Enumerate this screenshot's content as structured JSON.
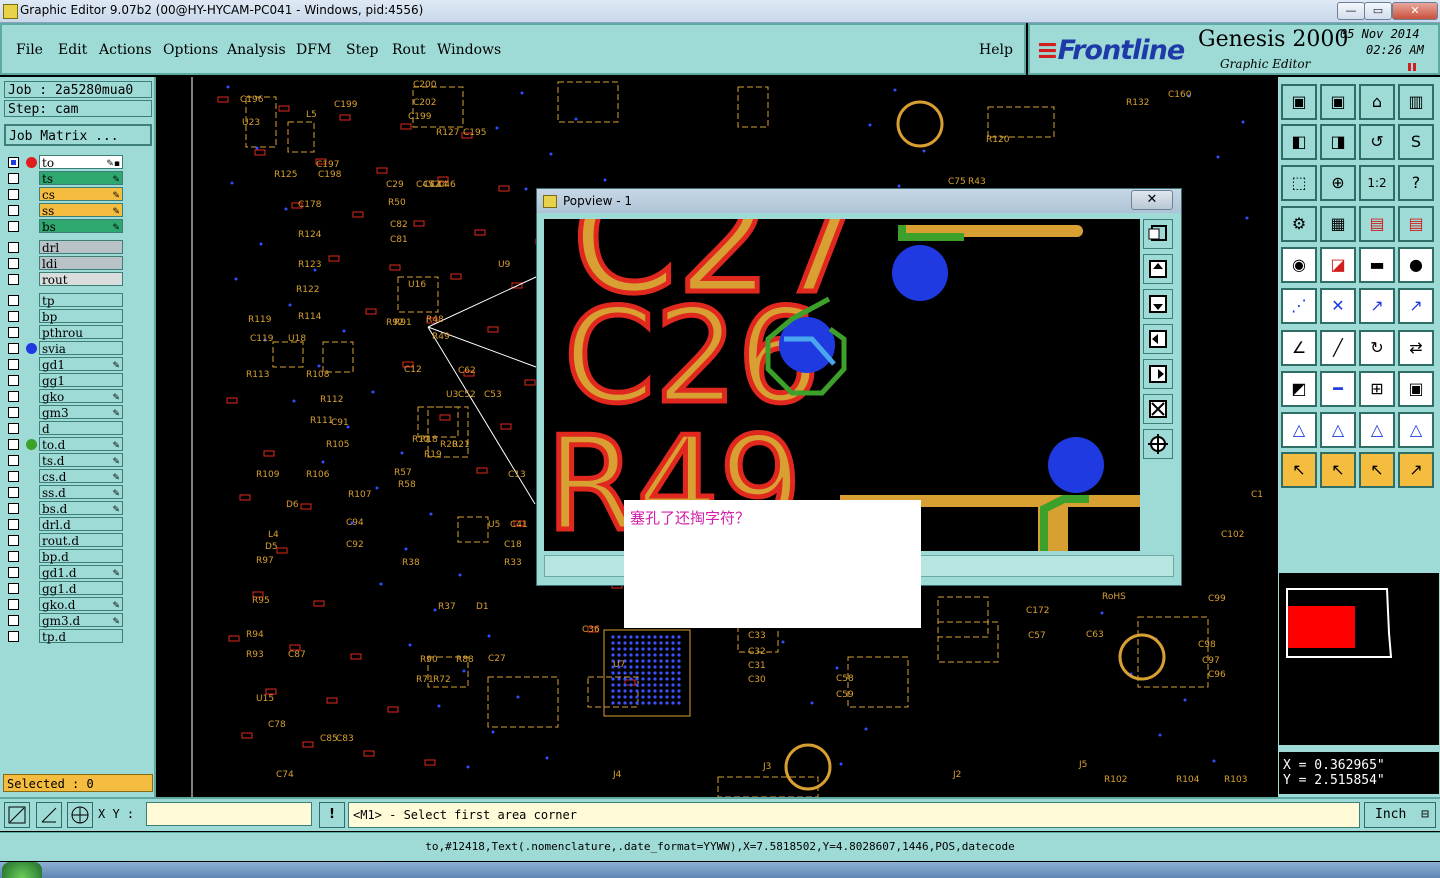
{
  "window": {
    "title": "Graphic Editor 9.07b2 (00@HY-HYCAM-PC041 - Windows, pid:4556)",
    "controls": [
      "—",
      "▭",
      "✕"
    ]
  },
  "menubar": {
    "items": [
      "File",
      "Edit",
      "Actions",
      "Options",
      "Analysis",
      "DFM",
      "Step",
      "Rout",
      "Windows"
    ],
    "help": "Help"
  },
  "brand": {
    "logo": "Frontline",
    "product": "Genesis 2000",
    "subtitle": "Graphic Editor",
    "date": "05 Nov 2014",
    "time": "02:26 AM"
  },
  "job": {
    "job_line": "Job : 2a5280mua0",
    "step_line": "Step: cam",
    "matrix_button": "Job Matrix ..."
  },
  "layers": [
    {
      "name": "to",
      "color": "#ffffff",
      "dot": "#e01e1e",
      "mark": "✎▪"
    },
    {
      "name": "ts",
      "color": "#2fa86f",
      "dot": "",
      "mark": "✎"
    },
    {
      "name": "cs",
      "color": "#f5bd40",
      "dot": "",
      "mark": "✎"
    },
    {
      "name": "ss",
      "color": "#f5bd40",
      "dot": "",
      "mark": "✎"
    },
    {
      "name": "bs",
      "color": "#2fa86f",
      "dot": "",
      "mark": "✎"
    },
    {
      "name": "drl",
      "color": "#b9c3c7",
      "dot": "",
      "mark": ""
    },
    {
      "name": "ldi",
      "color": "#b9c3c7",
      "dot": "",
      "mark": ""
    },
    {
      "name": "rout",
      "color": "#d9dedd",
      "dot": "",
      "mark": ""
    },
    {
      "name": "tp",
      "color": "#9edbd6",
      "dot": "",
      "mark": ""
    },
    {
      "name": "bp",
      "color": "#9edbd6",
      "dot": "",
      "mark": ""
    },
    {
      "name": "pthrou",
      "color": "#9edbd6",
      "dot": "",
      "mark": ""
    },
    {
      "name": "svia",
      "color": "#9edbd6",
      "dot": "#1e3ae0",
      "mark": ""
    },
    {
      "name": "gd1",
      "color": "#9edbd6",
      "dot": "",
      "mark": "✎"
    },
    {
      "name": "gg1",
      "color": "#9edbd6",
      "dot": "",
      "mark": ""
    },
    {
      "name": "gko",
      "color": "#9edbd6",
      "dot": "",
      "mark": "✎"
    },
    {
      "name": "gm3",
      "color": "#9edbd6",
      "dot": "",
      "mark": "✎"
    },
    {
      "name": "d",
      "color": "#9edbd6",
      "dot": "",
      "mark": ""
    },
    {
      "name": "to.d",
      "color": "#9edbd6",
      "dot": "#3ca02a",
      "mark": "✎"
    },
    {
      "name": "ts.d",
      "color": "#9edbd6",
      "dot": "",
      "mark": "✎"
    },
    {
      "name": "cs.d",
      "color": "#9edbd6",
      "dot": "",
      "mark": "✎"
    },
    {
      "name": "ss.d",
      "color": "#9edbd6",
      "dot": "",
      "mark": "✎"
    },
    {
      "name": "bs.d",
      "color": "#9edbd6",
      "dot": "",
      "mark": "✎"
    },
    {
      "name": "drl.d",
      "color": "#9edbd6",
      "dot": "",
      "mark": ""
    },
    {
      "name": "rout.d",
      "color": "#9edbd6",
      "dot": "",
      "mark": ""
    },
    {
      "name": "bp.d",
      "color": "#9edbd6",
      "dot": "",
      "mark": ""
    },
    {
      "name": "gd1.d",
      "color": "#9edbd6",
      "dot": "",
      "mark": "✎"
    },
    {
      "name": "gg1.d",
      "color": "#9edbd6",
      "dot": "",
      "mark": ""
    },
    {
      "name": "gko.d",
      "color": "#9edbd6",
      "dot": "",
      "mark": "✎"
    },
    {
      "name": "gm3.d",
      "color": "#9edbd6",
      "dot": "",
      "mark": "✎"
    },
    {
      "name": "tp.d",
      "color": "#9edbd6",
      "dot": "",
      "mark": ""
    }
  ],
  "selected_text": "Selected : 0",
  "popview": {
    "title": "Popview - 1",
    "close": "✕",
    "zoom_labels": [
      "C27",
      "C26",
      "R49"
    ]
  },
  "note_text": "塞孔了还掏字符？",
  "pcb_labels": [
    "C196",
    "C199",
    "U23",
    "L5",
    "C200",
    "C202",
    "C199",
    "R127",
    "C195",
    "R125",
    "C178",
    "C197",
    "C198",
    "R124",
    "R123",
    "R122",
    "R119",
    "R114",
    "C119",
    "U18",
    "R113",
    "R108",
    "R112",
    "C91",
    "R111",
    "R109",
    "R106",
    "R105",
    "R107",
    "D6",
    "C94",
    "C92",
    "L4",
    "D5",
    "R97",
    "R95",
    "R94",
    "R93",
    "C87",
    "U15",
    "C78",
    "C74",
    "C85",
    "C83",
    "C29",
    "R50",
    "C45",
    "C42",
    "C44",
    "C46",
    "C82",
    "C81",
    "U16",
    "U9",
    "R92",
    "R91",
    "R48",
    "R49",
    "C12",
    "U3",
    "C62",
    "C52",
    "C53",
    "R18",
    "R19",
    "R20",
    "R21",
    "R17",
    "C13",
    "R57",
    "R58",
    "U5",
    "C18",
    "C41",
    "R38",
    "R33",
    "R37",
    "D1",
    "R90",
    "R88",
    "C27",
    "R71",
    "R72",
    "C75",
    "R43",
    "R120",
    "R132",
    "C160",
    "C172",
    "C57",
    "C63",
    "RoHS",
    "C99",
    "C98",
    "C97",
    "C96",
    "C33",
    "C32",
    "C31",
    "C30",
    "C58",
    "C59",
    "U7",
    "C36",
    "J4",
    "J3",
    "J2",
    "J5",
    "R102",
    "R104",
    "R103",
    "C102",
    "C1"
  ],
  "tool_icons": [
    "open-job-icon",
    "save-icon",
    "home-icon",
    "window-icon",
    "import-icon",
    "export-icon",
    "step-icon",
    "snake-icon",
    "fit-icon",
    "zoom-icon",
    "scale-12-icon",
    "help-icon",
    "measure-icon",
    "grid-icon",
    "layers-icon",
    "layers-red-icon",
    "feature-icon",
    "color-icon",
    "ruler-icon",
    "dot-icon",
    "net-icon",
    "cross-icon",
    "line-icon",
    "arc-line-icon",
    "angle-icon",
    "draw-line-icon",
    "rotate-icon",
    "mirror-icon",
    "snap-icon",
    "minus-icon",
    "pad-icon",
    "group-icon",
    "triangle-a-icon",
    "triangle-b-icon",
    "triangle-c-icon",
    "triangle-d-icon",
    "pointer-icon",
    "select-pointer-icon",
    "circle-pointer-icon",
    "route-pointer-icon"
  ],
  "tool_glyphs": [
    "▣",
    "▣",
    "⌂",
    "▥",
    "◧",
    "◨",
    "↺",
    "S",
    "⬚",
    "⊕",
    "1:2",
    "?",
    "⚙",
    "▦",
    "▤",
    "▤",
    "◉",
    "◪",
    "▬",
    "●",
    "⋰",
    "✕",
    "↗",
    "↗",
    "∠",
    "╱",
    "↻",
    "⇄",
    "◩",
    "━",
    "⊞",
    "▣",
    "△",
    "△",
    "△",
    "△",
    "↖",
    "↖",
    "↖",
    "↗"
  ],
  "coords": {
    "x": "X  = 0.362965\"",
    "y": "Y  = 2.515854\""
  },
  "bottom": {
    "xy_label": "X Y :",
    "bang": "!",
    "message": "<M1> - Select first area corner",
    "units": "Inch",
    "status_line": "to,#12418,Text(.nomenclature,.date_format=YYWW),X=7.5818502,Y=4.8028607,1446,POS,datecode"
  },
  "colors": {
    "panel": "#9edbd6",
    "silk": "#d8a032",
    "outline_red": "#e0281e",
    "via_blue": "#1e3ae0",
    "mask_green": "#3ca02a"
  }
}
